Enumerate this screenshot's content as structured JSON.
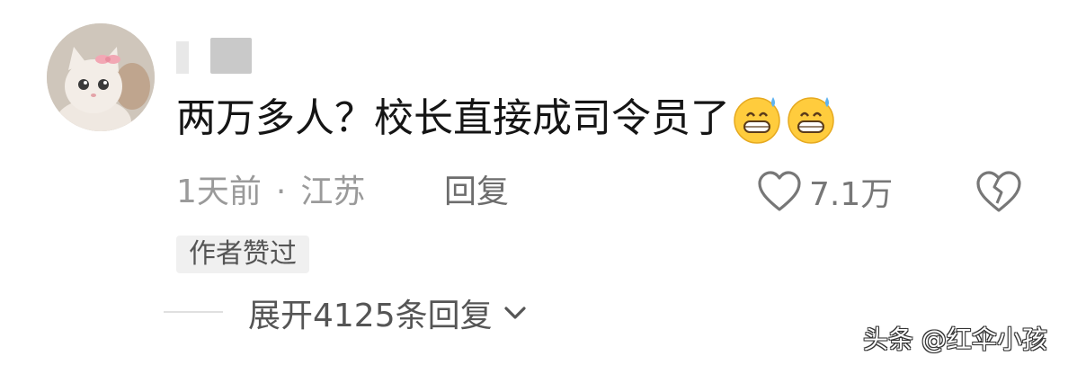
{
  "comment": {
    "text": "两万多人？校长直接成司令员了",
    "emojis": [
      "grinning-sweat-emoji",
      "grinning-sweat-emoji"
    ]
  },
  "meta": {
    "time": "1天前",
    "separator": "·",
    "location": "江苏",
    "reply_label": "回复"
  },
  "likes": {
    "count": "7.1万"
  },
  "badge": {
    "label": "作者赞过"
  },
  "replies": {
    "expand_label": "展开4125条回复"
  },
  "watermark": {
    "text": "头条 @红伞小孩"
  },
  "colors": {
    "meta_gray": "#9a9a9a",
    "badge_bg": "#f0f0f0",
    "text": "#151515"
  },
  "icons": {
    "like": "heart-outline-icon",
    "dislike": "broken-heart-icon",
    "expand": "chevron-down-icon"
  }
}
